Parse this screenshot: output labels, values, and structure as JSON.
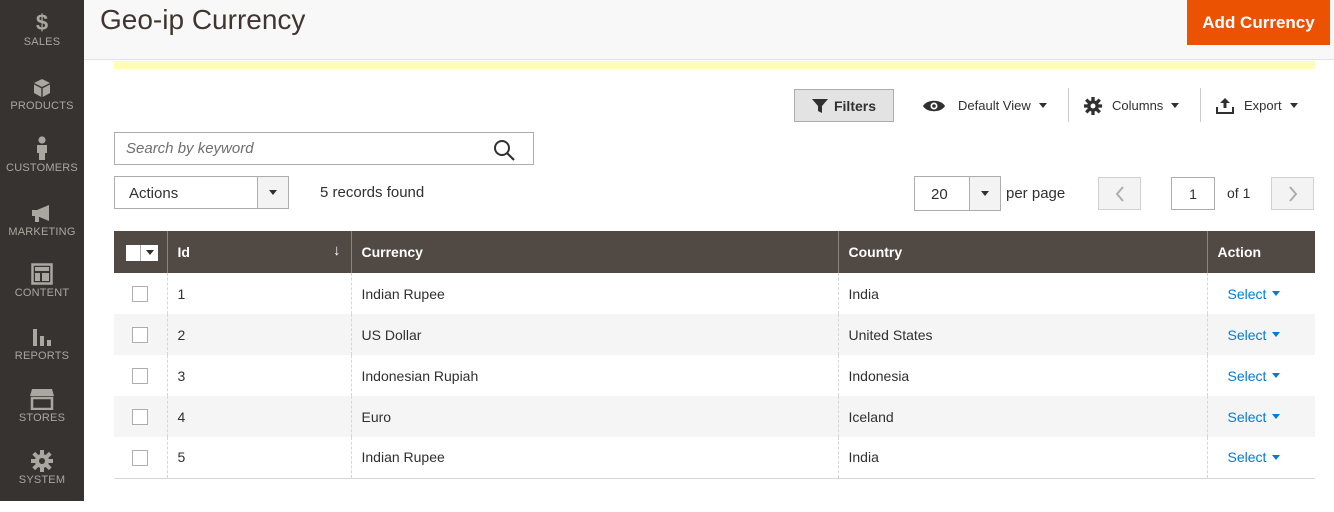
{
  "sidebar": {
    "items": [
      {
        "label": "SALES",
        "icon": "dollar-icon"
      },
      {
        "label": "PRODUCTS",
        "icon": "box-icon"
      },
      {
        "label": "CUSTOMERS",
        "icon": "person-icon"
      },
      {
        "label": "MARKETING",
        "icon": "megaphone-icon"
      },
      {
        "label": "CONTENT",
        "icon": "layout-icon"
      },
      {
        "label": "REPORTS",
        "icon": "bar-chart-icon"
      },
      {
        "label": "STORES",
        "icon": "store-icon"
      },
      {
        "label": "SYSTEM",
        "icon": "gear-icon"
      }
    ]
  },
  "header": {
    "title": "Geo-ip Currency",
    "add_button": "Add Currency"
  },
  "toolbar": {
    "filters": "Filters",
    "view": "Default View",
    "columns": "Columns",
    "export": "Export"
  },
  "search": {
    "placeholder": "Search by keyword"
  },
  "actions": {
    "label": "Actions"
  },
  "records_found": "5 records found",
  "pagination": {
    "per_page_value": "20",
    "per_page_label": "per page",
    "current_page": "1",
    "of_label": "of 1"
  },
  "grid": {
    "columns": [
      "Id",
      "Currency",
      "Country",
      "Action"
    ],
    "rows": [
      {
        "id": "1",
        "currency": "Indian Rupee",
        "country": "India",
        "action": "Select"
      },
      {
        "id": "2",
        "currency": "US Dollar",
        "country": "United States",
        "action": "Select"
      },
      {
        "id": "3",
        "currency": "Indonesian Rupiah",
        "country": "Indonesia",
        "action": "Select"
      },
      {
        "id": "4",
        "currency": "Euro",
        "country": "Iceland",
        "action": "Select"
      },
      {
        "id": "5",
        "currency": "Indian Rupee",
        "country": "India",
        "action": "Select"
      }
    ]
  },
  "colors": {
    "sidebar_bg": "#373330",
    "accent": "#eb5202",
    "table_header": "#514943",
    "link": "#007bdb"
  }
}
